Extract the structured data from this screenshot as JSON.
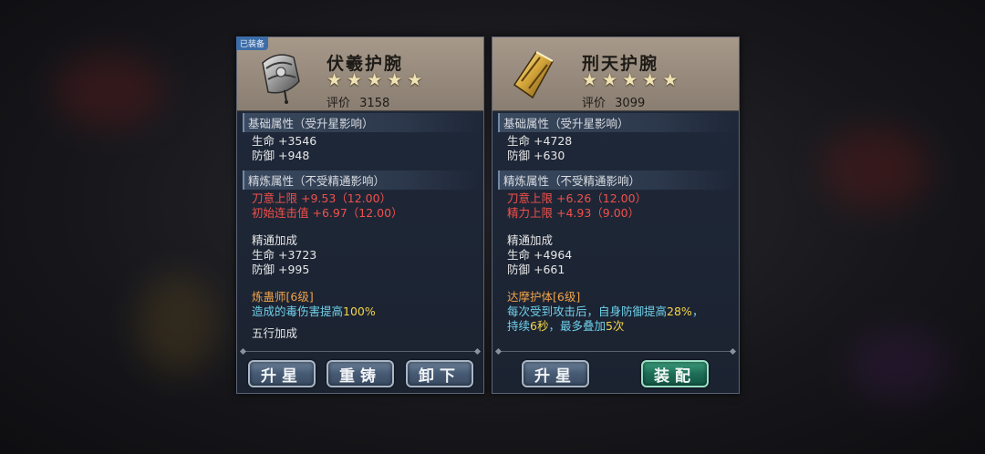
{
  "left_panel": {
    "badge": "已装备",
    "name": "伏羲护腕",
    "stars": [
      "★",
      "★",
      "★",
      "★",
      "★"
    ],
    "rating_label": "评价",
    "rating_value": "3158",
    "base_header": "基础属性（受升星影响）",
    "base_stats": [
      "生命 +3546",
      "防御 +948"
    ],
    "refine_header": "精炼属性（不受精通影响）",
    "refine_stats": [
      "刀意上限 +9.53（12.00）",
      "初始连击值 +6.97（12.00）"
    ],
    "mastery_title": "精通加成",
    "mastery_stats": [
      "生命 +3723",
      "防御 +995"
    ],
    "skill_title": "炼蛊师[6级]",
    "skill_desc_prefix": "造成的毒伤害提高",
    "skill_desc_value": "100%",
    "wuxing_title": "五行加成",
    "buttons": {
      "star_up": "升星",
      "recast": "重铸",
      "unequip": "卸下"
    }
  },
  "right_panel": {
    "name": "刑天护腕",
    "stars": [
      "★",
      "★",
      "★",
      "★",
      "★"
    ],
    "rating_label": "评价",
    "rating_value": "3099",
    "base_header": "基础属性（受升星影响）",
    "base_stats": [
      "生命 +4728",
      "防御 +630"
    ],
    "refine_header": "精炼属性（不受精通影响）",
    "refine_stats": [
      "刀意上限 +6.26（12.00）",
      "精力上限 +4.93（9.00）"
    ],
    "mastery_title": "精通加成",
    "mastery_stats": [
      "生命 +4964",
      "防御 +661"
    ],
    "skill_title": "达摩护体[6级]",
    "skill_line1_prefix": "每次受到攻击后，自身防御提高",
    "skill_line1_value": "28%",
    "skill_line1_suffix": "，",
    "skill_line2_a": "持续",
    "skill_line2_v1": "6秒",
    "skill_line2_b": "，最多叠加",
    "skill_line2_v2": "5次",
    "buttons": {
      "star_up": "升星",
      "equip": "装配"
    }
  },
  "colors": {
    "highlight_yellow": "#f4d44b",
    "stat_red": "#f0504a",
    "skill_orange": "#f0a24a",
    "skill_cyan": "#6fd0ea",
    "equip_green": "#1d6d56"
  }
}
